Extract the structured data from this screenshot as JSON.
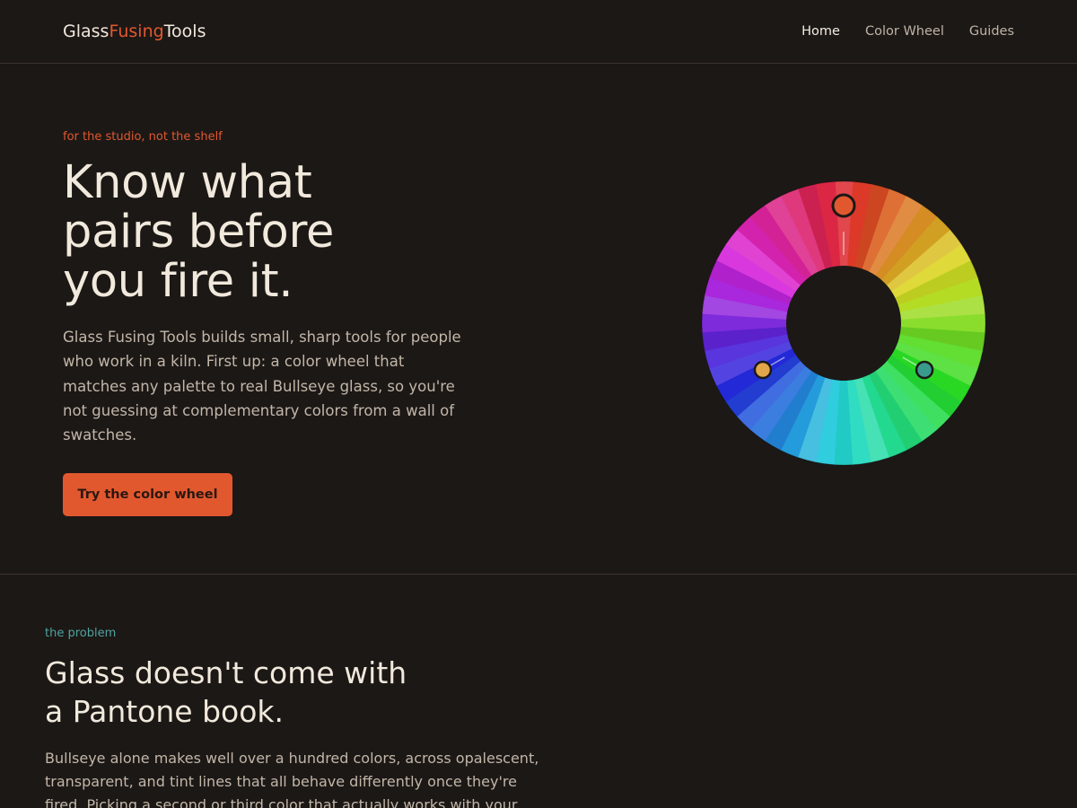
{
  "header": {
    "brand": {
      "part1": "Glass",
      "part2": "Fusing",
      "part3": "Tools"
    },
    "nav": [
      {
        "label": "Home",
        "active": true
      },
      {
        "label": "Color Wheel",
        "active": false
      },
      {
        "label": "Guides",
        "active": false
      }
    ]
  },
  "hero": {
    "eyebrow": "for the studio, not the shelf",
    "title_lines": [
      "Know what",
      "pairs before",
      "you fire it."
    ],
    "lede": "Glass Fusing Tools builds small, sharp tools for people who work in a kiln. First up: a color wheel that matches any palette to real Bullseye glass, so you're not guessing at complementary colors from a wall of swatches.",
    "cta_label": "Try the color wheel",
    "wheel": {
      "markers": [
        {
          "name": "base-color-marker",
          "color": "#e2582e"
        },
        {
          "name": "second-color-marker",
          "color": "#3a9a8c"
        },
        {
          "name": "third-color-marker",
          "color": "#e2a64a"
        }
      ]
    }
  },
  "problem": {
    "eyebrow": "the problem",
    "title_lines": [
      "Glass doesn't come with",
      "a Pantone book."
    ],
    "body": "Bullseye alone makes well over a hundred colors, across opalescent, transparent, and tint lines that all behave differently once they're fired. Picking a second or third color that actually works with your base usually"
  },
  "colors": {
    "background": "#1c1816",
    "accent": "#e2582e",
    "teal": "#4fa3a0",
    "text": "#f1e9dc",
    "muted": "#c2b6a8"
  }
}
